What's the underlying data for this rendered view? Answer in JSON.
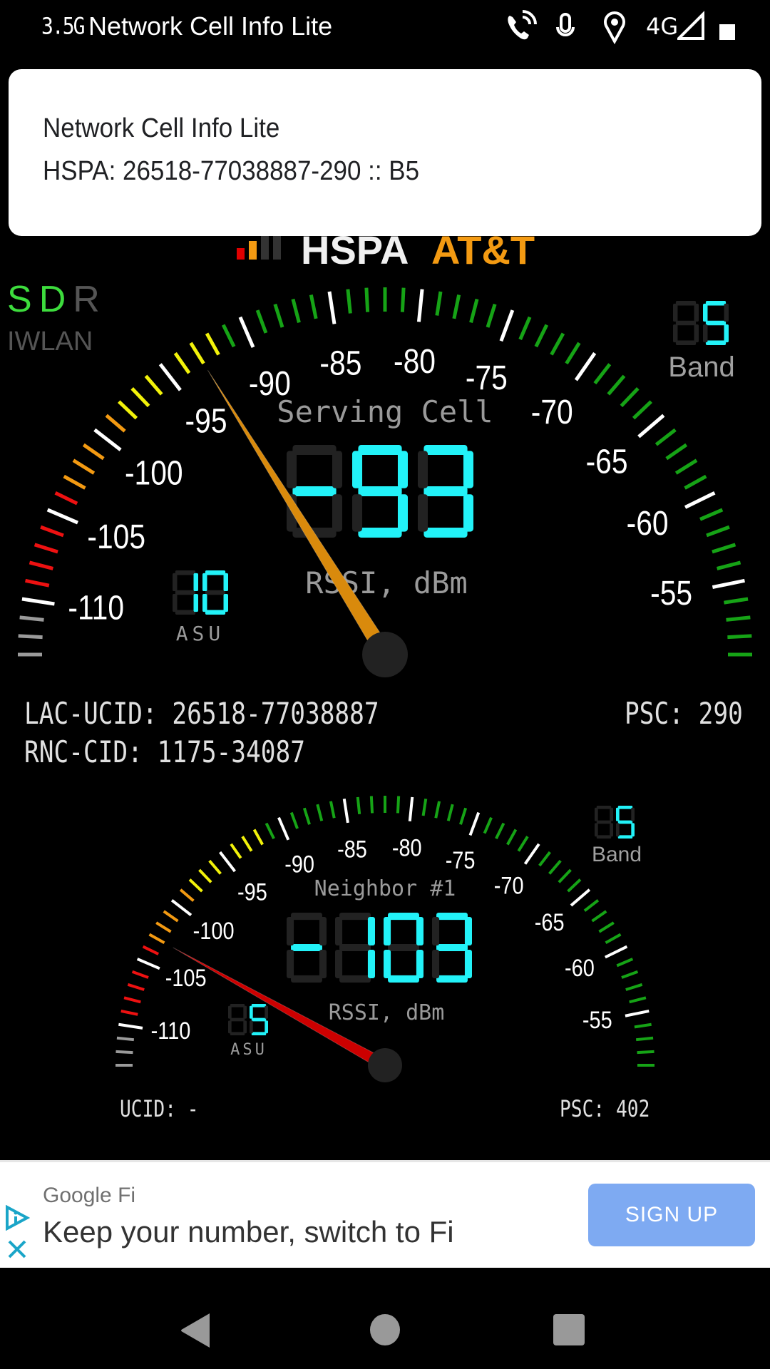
{
  "status_bar": {
    "network_lcd": "3.5G",
    "app_title": "Network Cell Info Lite",
    "icons": [
      "wifi-calling-icon",
      "mic-icon",
      "location-icon",
      "4g-label",
      "signal-icon",
      "battery-icon"
    ],
    "network_type": "4G"
  },
  "notification": {
    "title": "Network Cell Info Lite",
    "text": "HSPA: 26518-77038887-290 :: B5"
  },
  "header": {
    "technology": "HSPA",
    "carrier": "AT&T",
    "carrier_color": "#f39a12",
    "sdr": [
      {
        "letter": "S",
        "color": "#3ddc3d"
      },
      {
        "letter": "D",
        "color": "#3ddc3d"
      },
      {
        "letter": "R",
        "color": "#555555"
      }
    ],
    "iwlan": "IWLAN"
  },
  "serving_gauge": {
    "title": "Serving Cell",
    "value": -93,
    "value_text": "-93",
    "unit": "RSSI, dBm",
    "asu": "10",
    "asu_label": "ASU",
    "band": "5",
    "band_label": "Band",
    "needle_color": "#d98a0c",
    "scale_min": -113,
    "scale_max": -51,
    "labels": [
      -110,
      -105,
      -100,
      -95,
      -90,
      -85,
      -80,
      -75,
      -70,
      -65,
      -60,
      -55
    ]
  },
  "serving_info": {
    "lac_ucid": "LAC-UCID:  26518-77038887",
    "rnc_cid": "RNC-CID:  1175-34087",
    "psc": "PSC:  290"
  },
  "neighbor_gauge": {
    "title": "Neighbor #1",
    "value": -103,
    "value_text": "-103",
    "unit": "RSSI, dBm",
    "asu": "5",
    "asu_label": "ASU",
    "band": "5",
    "band_label": "Band",
    "needle_color": "#cc0000",
    "scale_min": -113,
    "scale_max": -51,
    "labels": [
      -110,
      -105,
      -100,
      -95,
      -90,
      -85,
      -80,
      -75,
      -70,
      -65,
      -60,
      -55
    ]
  },
  "neighbor_info": {
    "ucid": "UCID:  -",
    "psc": "PSC:  402"
  },
  "ad": {
    "brand": "Google Fi",
    "text": "Keep your number, switch to Fi",
    "button": "SIGN UP"
  },
  "nav": {
    "back": "back-button",
    "home": "home-button",
    "recents": "recents-button"
  }
}
